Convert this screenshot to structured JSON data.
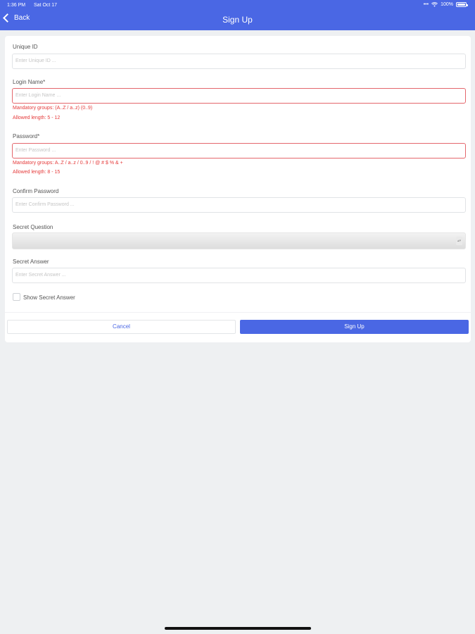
{
  "status_bar": {
    "time": "1:36 PM",
    "date": "Sat Oct 17",
    "dots": "•••",
    "battery": "100%",
    "battery_level": 1.0
  },
  "nav": {
    "back_label": "Back",
    "title": "Sign Up"
  },
  "form": {
    "unique_id": {
      "label": "Unique ID",
      "placeholder": "Enter Unique ID ..."
    },
    "login_name": {
      "label": "Login Name*",
      "placeholder": "Enter Login Name ...",
      "hint_groups": "Mandatory groups: (A..Z / a..z) (0..9)",
      "hint_length": "Allowed length: 5 - 12"
    },
    "password": {
      "label": "Password*",
      "placeholder": "Enter Password ...",
      "hint_groups": "Mandatory groups: A..Z / a..z / 0..9 / ! @ # $ % & +",
      "hint_length": "Allowed length: 8 - 15"
    },
    "confirm_password": {
      "label": "Confirm Password",
      "placeholder": "Enter Confirm Password ..."
    },
    "secret_question": {
      "label": "Secret Question",
      "value": "",
      "arrow": "▴▾"
    },
    "secret_answer": {
      "label": "Secret Answer",
      "placeholder": "Enter Secret Answer ..."
    },
    "show_secret_answer": {
      "label": "Show Secret Answer",
      "checked": false
    }
  },
  "buttons": {
    "cancel": "Cancel",
    "sign_up": "Sign Up"
  },
  "colors": {
    "accent": "#4a67e4",
    "error": "#e53a3a",
    "error_border": "#e4676c",
    "background": "#eef0f2"
  },
  "icons": {
    "back": "chevron-left-icon",
    "wifi": "wifi-icon",
    "battery": "battery-icon",
    "select": "chevron-updown-icon",
    "checkbox": "checkbox-icon"
  }
}
